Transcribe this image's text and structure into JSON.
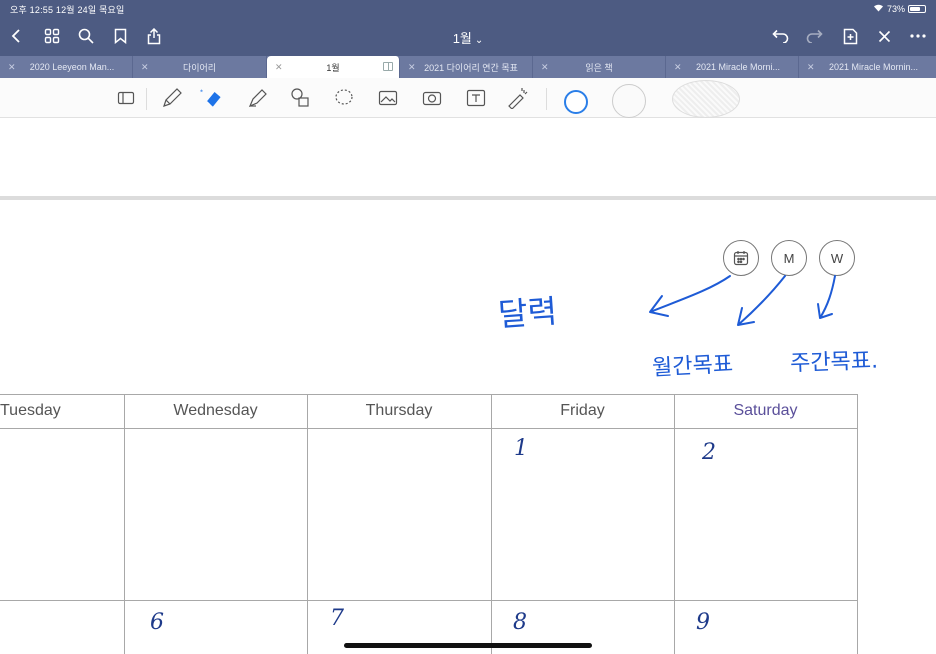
{
  "status_bar": {
    "time_date": "오후 12:55  12월 24일 목요일",
    "battery": "73%",
    "battery_level": 0.73
  },
  "nav": {
    "title": "1월",
    "title_chevron": "⌄"
  },
  "tabs": [
    {
      "label": "2020 Leeyeon Man...",
      "active": false
    },
    {
      "label": "다이어리",
      "active": false
    },
    {
      "label": "1월",
      "active": true
    },
    {
      "label": "2021 다이어리 연간 목표",
      "active": false
    },
    {
      "label": "읽은 책",
      "active": false
    },
    {
      "label": "2021 Miracle Morni...",
      "active": false
    },
    {
      "label": "2021 Miracle Mornin...",
      "active": false
    }
  ],
  "tools": {
    "colors": [
      "#1e73e8",
      "#ffffff",
      "#ffffff"
    ]
  },
  "page_buttons": {
    "calendar": "calendar-icon",
    "monthly": "M",
    "weekly": "W"
  },
  "annotations": {
    "calendar_note": "달력",
    "monthly_note": "월간목표",
    "weekly_note": "주간목표."
  },
  "calendar": {
    "headers": [
      "Tuesday",
      "Wednesday",
      "Thursday",
      "Friday",
      "Saturday"
    ],
    "saturday_color": "#5a4f9a",
    "row1": [
      "",
      "",
      "",
      "1",
      "2"
    ],
    "row2": [
      "",
      "6",
      "7",
      "8",
      "9"
    ]
  },
  "colors": {
    "topbar": "#4d5b82",
    "tabbar": "#6c79a0",
    "ink": "#1e5bd6"
  }
}
